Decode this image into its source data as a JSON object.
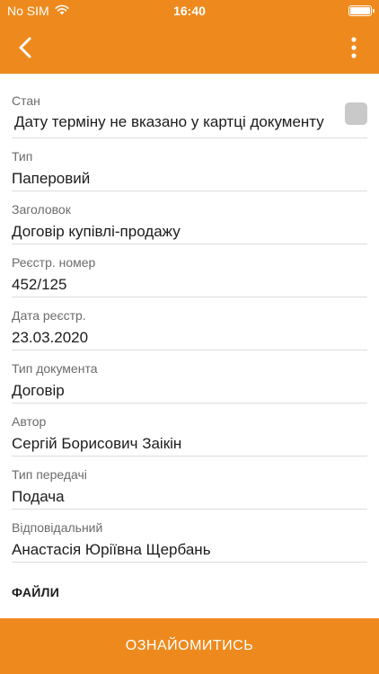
{
  "status_bar": {
    "carrier": "No SIM",
    "time": "16:40",
    "wifi_icon": "wifi-icon",
    "battery_icon": "battery-icon",
    "battery_level": 1.0
  },
  "app_bar": {
    "back_icon": "chevron-left-icon",
    "menu_icon": "more-vert-icon",
    "color": "#ee8a1d"
  },
  "fields": {
    "status": {
      "label": "Стан",
      "value": "Дату терміну не вказано у картці документу",
      "checked": false
    },
    "type": {
      "label": "Тип",
      "value": "Паперовий"
    },
    "title": {
      "label": "Заголовок",
      "value": "Договір купівлі-продажу"
    },
    "reg_number": {
      "label": "Реєстр. номер",
      "value": "452/125"
    },
    "reg_date": {
      "label": "Дата реєстр.",
      "value": "23.03.2020"
    },
    "doc_type": {
      "label": "Тип документа",
      "value": "Договір"
    },
    "author": {
      "label": "Автор",
      "value": "Сергій Борисович Заікін"
    },
    "transfer_type": {
      "label": "Тип передачі",
      "value": "Подача"
    },
    "responsible": {
      "label": "Відповідальний",
      "value": "Анастасія Юріївна Щербань"
    }
  },
  "files": {
    "title": "ФАЙЛИ"
  },
  "action": {
    "label": "ОЗНАЙОМИТИСЬ"
  }
}
